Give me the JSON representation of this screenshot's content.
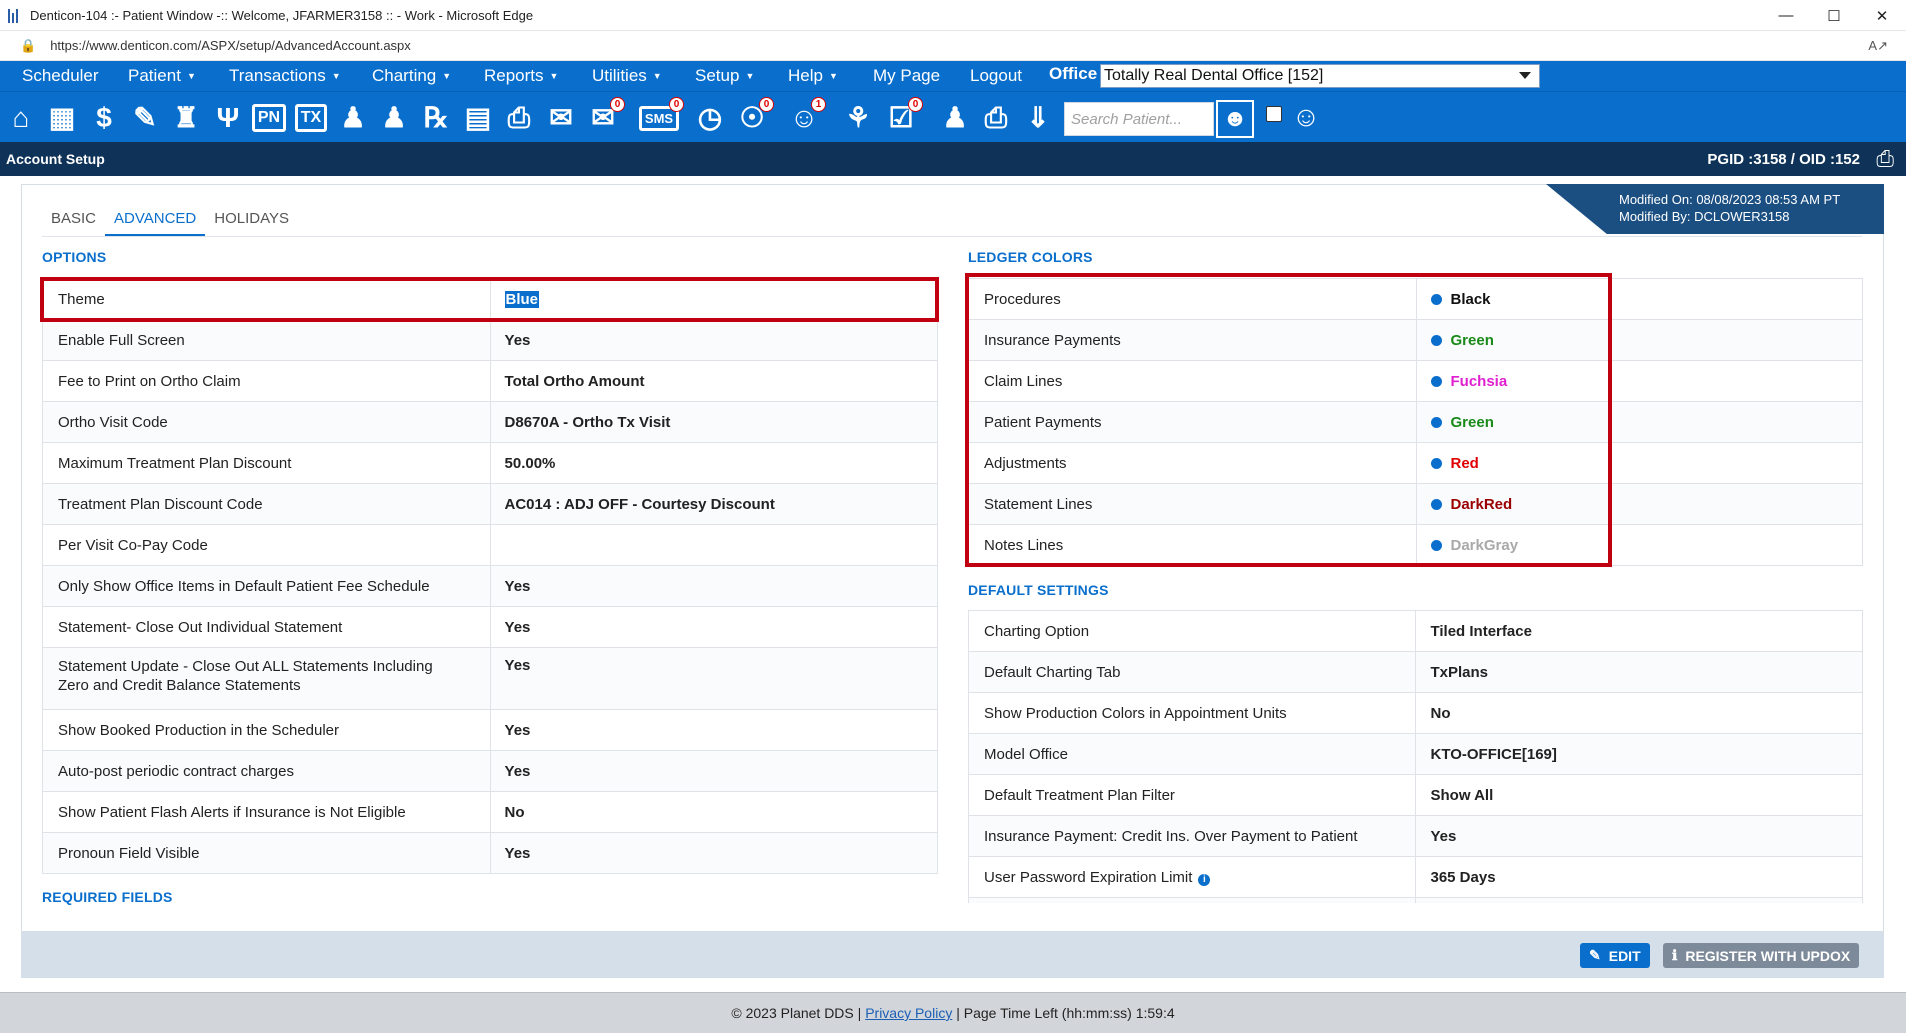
{
  "window": {
    "title": "Denticon-104 :- Patient Window -:: Welcome, JFARMER3158 :: - Work - Microsoft Edge",
    "url": "https://www.denticon.com/ASPX/setup/AdvancedAccount.aspx"
  },
  "menu": {
    "items": [
      {
        "label": "Scheduler",
        "caret": false
      },
      {
        "label": "Patient",
        "caret": true
      },
      {
        "label": "Transactions",
        "caret": true
      },
      {
        "label": "Charting",
        "caret": true
      },
      {
        "label": "Reports",
        "caret": true
      },
      {
        "label": "Utilities",
        "caret": true
      },
      {
        "label": "Setup",
        "caret": true
      },
      {
        "label": "Help",
        "caret": true
      },
      {
        "label": "My Page",
        "caret": false
      },
      {
        "label": "Logout",
        "caret": false
      }
    ],
    "office_label": "Office",
    "office_value": "Totally Real Dental Office [152]"
  },
  "toolbar": {
    "badges": {
      "mail": "0",
      "sms": "0",
      "globe": "0",
      "alerts": "1",
      "tasks": "0"
    },
    "pn": "PN",
    "tx": "TX",
    "sms": "SMS",
    "search_placeholder": "Search Patient..."
  },
  "section": {
    "title": "Account Setup",
    "ids": "PGID :3158  /  OID :152"
  },
  "modified": {
    "on": "Modified On: 08/08/2023 08:53 AM PT",
    "by": "Modified By: DCLOWER3158"
  },
  "tabs": [
    "BASIC",
    "ADVANCED",
    "HOLIDAYS"
  ],
  "options": {
    "title": "OPTIONS",
    "rows": [
      {
        "label": "Theme",
        "value": "Blue"
      },
      {
        "label": "Enable Full Screen",
        "value": "Yes"
      },
      {
        "label": "Fee to Print on Ortho Claim",
        "value": "Total Ortho Amount"
      },
      {
        "label": "Ortho Visit Code",
        "value": "D8670A - Ortho Tx Visit"
      },
      {
        "label": "Maximum Treatment Plan Discount",
        "value": "50.00%"
      },
      {
        "label": "Treatment Plan Discount Code",
        "value": "AC014 : ADJ OFF - Courtesy Discount"
      },
      {
        "label": "Per Visit Co-Pay Code",
        "value": ""
      },
      {
        "label": "Only Show Office Items in Default Patient Fee Schedule",
        "value": "Yes"
      },
      {
        "label": "Statement- Close Out Individual Statement",
        "value": "Yes"
      },
      {
        "label": "Statement Update - Close Out ALL Statements Including Zero and Credit Balance Statements",
        "value": "Yes"
      },
      {
        "label": "Show Booked Production in the Scheduler",
        "value": "Yes"
      },
      {
        "label": "Auto-post periodic contract charges",
        "value": "Yes"
      },
      {
        "label": "Show Patient Flash Alerts if Insurance is Not Eligible",
        "value": "No"
      },
      {
        "label": "Pronoun Field Visible",
        "value": "Yes"
      }
    ]
  },
  "required_fields": {
    "title": "REQUIRED FIELDS"
  },
  "ledger": {
    "title": "LEDGER COLORS",
    "rows": [
      {
        "label": "Procedures",
        "value": "Black",
        "color": "#111111"
      },
      {
        "label": "Insurance Payments",
        "value": "Green",
        "color": "#1a8a1a"
      },
      {
        "label": "Claim Lines",
        "value": "Fuchsia",
        "color": "#e020d0"
      },
      {
        "label": "Patient Payments",
        "value": "Green",
        "color": "#1a8a1a"
      },
      {
        "label": "Adjustments",
        "value": "Red",
        "color": "#e00000"
      },
      {
        "label": "Statement Lines",
        "value": "DarkRed",
        "color": "#9b0000"
      },
      {
        "label": "Notes Lines",
        "value": "DarkGray",
        "color": "#a9a9a9"
      }
    ]
  },
  "defaults": {
    "title": "DEFAULT SETTINGS",
    "rows": [
      {
        "label": "Charting Option",
        "value": "Tiled Interface"
      },
      {
        "label": "Default Charting Tab",
        "value": "TxPlans"
      },
      {
        "label": "Show Production Colors in Appointment Units",
        "value": "No"
      },
      {
        "label": "Model Office",
        "value": "KTO-OFFICE[169]"
      },
      {
        "label": "Default Treatment Plan Filter",
        "value": "Show All"
      },
      {
        "label": "Insurance Payment: Credit Ins. Over Payment to Patient",
        "value": "Yes"
      },
      {
        "label": "User Password Expiration Limit",
        "value": "365 Days"
      }
    ]
  },
  "buttons": {
    "edit": "EDIT",
    "updox": "REGISTER WITH UPDOX"
  },
  "footer": {
    "copyright": "© 2023 Planet DDS |",
    "privacy": "Privacy Policy",
    "time_left": "| Page Time Left (hh:mm:ss) 1:59:4"
  }
}
